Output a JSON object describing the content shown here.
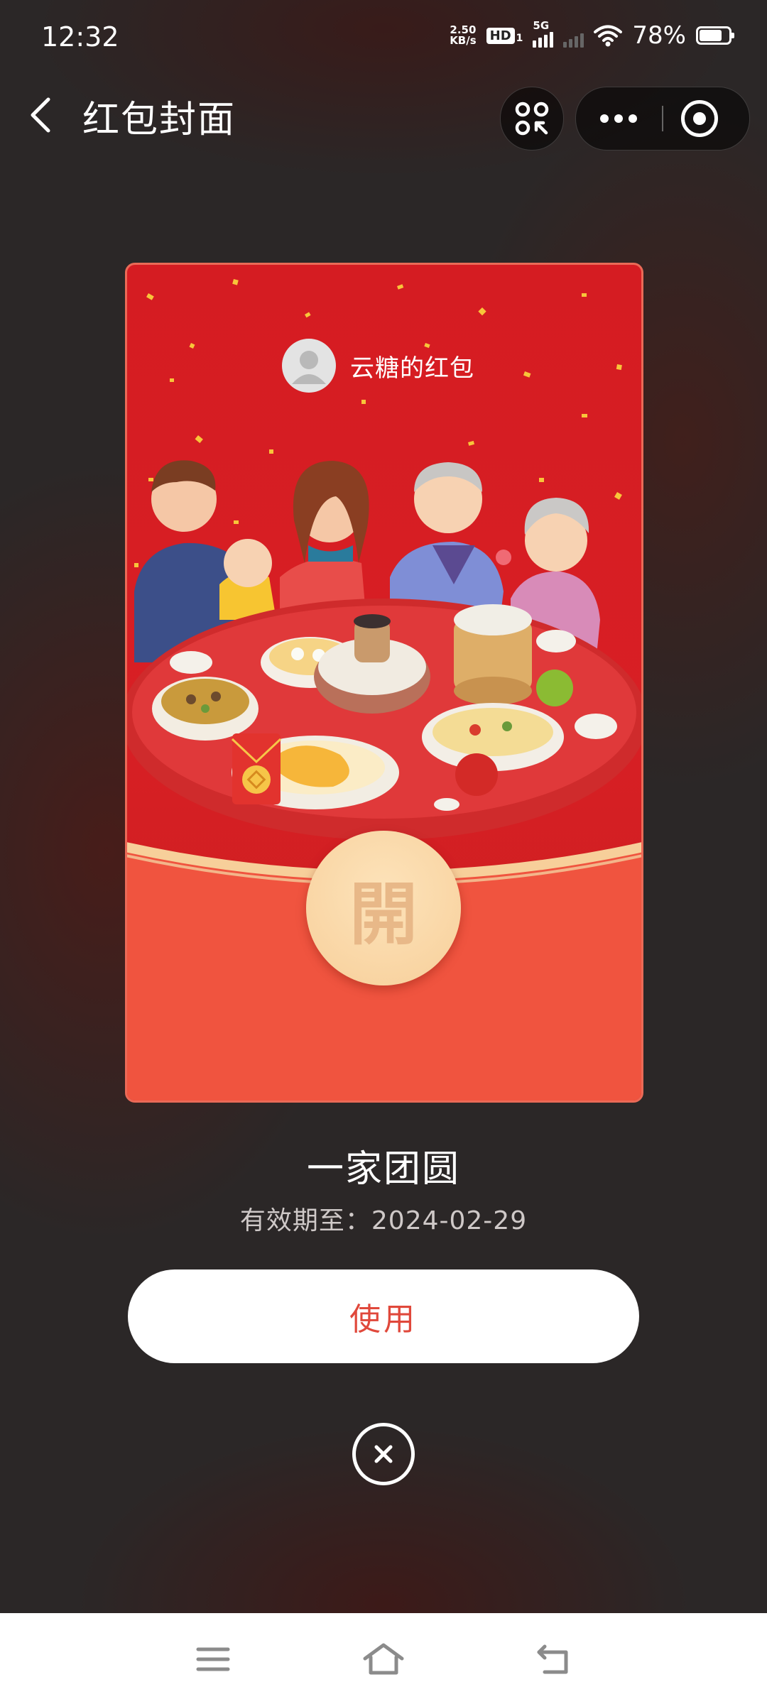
{
  "status_bar": {
    "time": "12:32",
    "net_speed_value": "2.50",
    "net_speed_unit": "KB/s",
    "hd_label": "HD",
    "hd_sub": "1",
    "network_type": "5G",
    "battery_percent": "78%",
    "battery_level": 0.78
  },
  "navbar": {
    "back_icon": "chevron-left-icon",
    "title": "红包封面",
    "scan_icon": "scan-icon",
    "more_icon": "more-dots-icon",
    "close_icon": "target-circle-icon"
  },
  "cover": {
    "sender_name": "云糖的红包",
    "avatar_icon": "default-avatar-icon",
    "open_label": "開",
    "colors": {
      "primary": "#d51c22",
      "lower": "#f0543f",
      "button": "#f7cf9a"
    }
  },
  "details": {
    "cover_name": "一家团圆",
    "validity_label": "有效期至：",
    "validity_date": "2024-02-29"
  },
  "actions": {
    "use_label": "使用",
    "close_icon": "close-circle-icon"
  },
  "system_nav": {
    "menu_icon": "menu-icon",
    "home_icon": "home-icon",
    "back_icon": "back-icon"
  }
}
